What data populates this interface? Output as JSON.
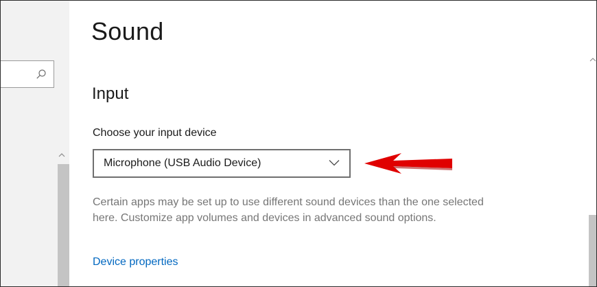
{
  "page": {
    "title": "Sound"
  },
  "search": {
    "icon": "search-icon",
    "value": ""
  },
  "input_section": {
    "title": "Input",
    "choose_label": "Choose your input device",
    "selected_device": "Microphone (USB Audio Device)",
    "description": "Certain apps may be set up to use different sound devices than the one selected here. Customize app volumes and devices in advanced sound options.",
    "link_label": "Device properties"
  },
  "colors": {
    "link": "#0067c0",
    "annotation_arrow": "#e00000",
    "description_text": "#767676",
    "scrollbar_thumb": "#c4c4c4"
  }
}
